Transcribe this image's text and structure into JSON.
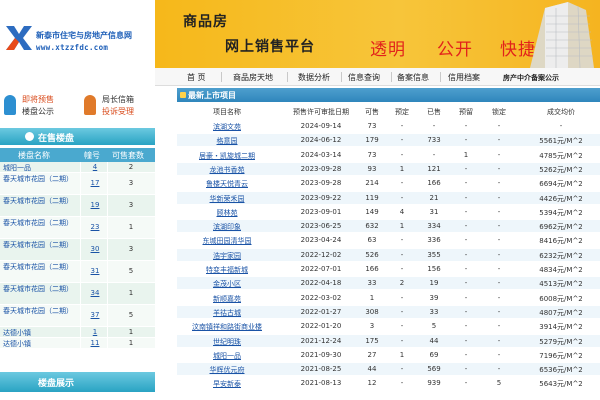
{
  "header": {
    "logo_title": "新泰市住宅与房地产信息网",
    "logo_url": "www.xtzzfdc.com",
    "banner_line1": "商品房",
    "banner_line2": "网上销售平台",
    "slogan": [
      "透明",
      "公开",
      "快捷"
    ]
  },
  "nav": {
    "items": [
      "首 页",
      "商品房天地",
      "数据分析",
      "信息查询",
      "备案信息",
      "信用档案"
    ],
    "filing": "房产中介备案公示"
  },
  "quick_links": [
    {
      "line1": "即将预售",
      "line2": "楼盘公示",
      "line2_red": false
    },
    {
      "line1": "局长信箱",
      "line2": "投诉受理",
      "line2_red": true
    }
  ],
  "onsale": {
    "title": "在售楼盘",
    "columns": [
      "楼盘名称",
      "幢号",
      "可售套数"
    ],
    "rows": [
      {
        "name": "城阳一品",
        "bld": "4",
        "cnt": "2"
      },
      {
        "name": "春天城市花园（二期）",
        "bld": "17",
        "cnt": "3"
      },
      {
        "name": "春天城市花园（二期）",
        "bld": "19",
        "cnt": "3"
      },
      {
        "name": "春天城市花园（二期）",
        "bld": "23",
        "cnt": "1"
      },
      {
        "name": "春天城市花园（二期）",
        "bld": "30",
        "cnt": "3"
      },
      {
        "name": "春天城市花园（二期）",
        "bld": "31",
        "cnt": "5"
      },
      {
        "name": "春天城市花园（二期）",
        "bld": "34",
        "cnt": "1"
      },
      {
        "name": "春天城市花园（二期）",
        "bld": "37",
        "cnt": "5"
      },
      {
        "name": "达德小镇",
        "bld": "1",
        "cnt": "1"
      },
      {
        "name": "达德小镇",
        "bld": "11",
        "cnt": "1"
      }
    ]
  },
  "showcase": {
    "title": "楼盘展示"
  },
  "new_projects": {
    "title": "最新上市项目",
    "columns": [
      "项目名称",
      "预售许可审批日期",
      "可售",
      "预定",
      "已售",
      "预留",
      "锁定",
      "成交均价"
    ],
    "rows": [
      {
        "name": "滨湖文苑",
        "date": "2024-09-14",
        "avail": "73",
        "reserve": "-",
        "sold": "-",
        "hold": "-",
        "lock": "-",
        "price": "-"
      },
      {
        "name": "格意园",
        "date": "2024-06-12",
        "avail": "179",
        "reserve": "-",
        "sold": "733",
        "hold": "-",
        "lock": "-",
        "price": "5561元/M^2"
      },
      {
        "name": "居豪・凯旋城二期",
        "date": "2024-03-14",
        "avail": "73",
        "reserve": "-",
        "sold": "-",
        "hold": "1",
        "lock": "-",
        "price": "4785元/M^2"
      },
      {
        "name": "龙池书香苑",
        "date": "2023-09-28",
        "avail": "93",
        "reserve": "1",
        "sold": "121",
        "hold": "-",
        "lock": "-",
        "price": "5262元/M^2"
      },
      {
        "name": "鲁楼天悦青云",
        "date": "2023-09-28",
        "avail": "214",
        "reserve": "-",
        "sold": "166",
        "hold": "-",
        "lock": "-",
        "price": "6694元/M^2"
      },
      {
        "name": "华新荣禾园",
        "date": "2023-09-22",
        "avail": "119",
        "reserve": "-",
        "sold": "21",
        "hold": "-",
        "lock": "-",
        "price": "4426元/M^2"
      },
      {
        "name": "颐林苑",
        "date": "2023-09-01",
        "avail": "149",
        "reserve": "4",
        "sold": "31",
        "hold": "-",
        "lock": "-",
        "price": "5394元/M^2"
      },
      {
        "name": "滨湖印象",
        "date": "2023-06-25",
        "avail": "632",
        "reserve": "1",
        "sold": "334",
        "hold": "-",
        "lock": "-",
        "price": "6962元/M^2"
      },
      {
        "name": "东城田园清华园",
        "date": "2023-04-24",
        "avail": "63",
        "reserve": "-",
        "sold": "336",
        "hold": "-",
        "lock": "-",
        "price": "8416元/M^2"
      },
      {
        "name": "浩宇家园",
        "date": "2022-12-02",
        "avail": "526",
        "reserve": "-",
        "sold": "355",
        "hold": "-",
        "lock": "-",
        "price": "6232元/M^2"
      },
      {
        "name": "特变丰福新城",
        "date": "2022-07-01",
        "avail": "166",
        "reserve": "-",
        "sold": "156",
        "hold": "-",
        "lock": "-",
        "price": "4834元/M^2"
      },
      {
        "name": "金茂小区",
        "date": "2022-04-18",
        "avail": "33",
        "reserve": "2",
        "sold": "19",
        "hold": "-",
        "lock": "-",
        "price": "4513元/M^2"
      },
      {
        "name": "新顺嘉苑",
        "date": "2022-03-02",
        "avail": "1",
        "reserve": "-",
        "sold": "39",
        "hold": "-",
        "lock": "-",
        "price": "6008元/M^2"
      },
      {
        "name": "羊祜古城",
        "date": "2022-01-27",
        "avail": "308",
        "reserve": "-",
        "sold": "33",
        "hold": "-",
        "lock": "-",
        "price": "4807元/M^2"
      },
      {
        "name": "汶南镇祥和路街商业楼",
        "date": "2022-01-20",
        "avail": "3",
        "reserve": "-",
        "sold": "5",
        "hold": "-",
        "lock": "-",
        "price": "3914元/M^2"
      },
      {
        "name": "世纪明珠",
        "date": "2021-12-24",
        "avail": "175",
        "reserve": "-",
        "sold": "44",
        "hold": "-",
        "lock": "-",
        "price": "5279元/M^2"
      },
      {
        "name": "城阳一品",
        "date": "2021-09-30",
        "avail": "27",
        "reserve": "1",
        "sold": "69",
        "hold": "-",
        "lock": "-",
        "price": "7196元/M^2"
      },
      {
        "name": "华辉优元府",
        "date": "2021-08-25",
        "avail": "44",
        "reserve": "-",
        "sold": "569",
        "hold": "-",
        "lock": "-",
        "price": "6536元/M^2"
      },
      {
        "name": "早安新泰",
        "date": "2021-08-13",
        "avail": "12",
        "reserve": "-",
        "sold": "939",
        "hold": "-",
        "lock": "5",
        "price": "5643元/M^2"
      }
    ]
  },
  "colors": {
    "banner": "#f6b81a",
    "slogan": "#e2221b",
    "header_blue": "#2f86bc",
    "left_teal": "#29a3c3",
    "link_blue": "#1a53a6"
  }
}
